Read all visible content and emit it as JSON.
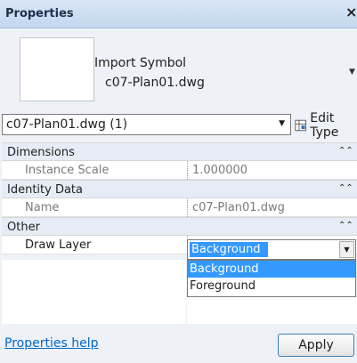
{
  "window": {
    "title": "Properties",
    "close_glyph": "×"
  },
  "type_selector": {
    "family": "Import Symbol",
    "type_name": "c07-Plan01.dwg",
    "dropdown_arrow": "▼"
  },
  "instance_filter": {
    "value": "c07-Plan01.dwg (1)",
    "arrow": "▼"
  },
  "edit_type": {
    "label": "Edit Type"
  },
  "groups": {
    "dimensions": {
      "label": "Dimensions",
      "collapse_glyph": "⌃⌃"
    },
    "identity": {
      "label": "Identity Data",
      "collapse_glyph": "⌃⌃"
    },
    "other": {
      "label": "Other",
      "collapse_glyph": "⌃⌃"
    }
  },
  "properties": {
    "instance_scale": {
      "name": "Instance Scale",
      "value": "1.000000"
    },
    "name": {
      "name": "Name",
      "value": "c07-Plan01.dwg"
    },
    "draw_layer": {
      "name": "Draw Layer",
      "value": "Background"
    }
  },
  "draw_layer_options": [
    "Background",
    "Foreground"
  ],
  "draw_layer_highlighted": "Background",
  "footer": {
    "help_link": "Properties help",
    "apply_label": "Apply"
  },
  "colors": {
    "selection": "#3399ff",
    "link": "#0066cc",
    "header_bg": "#e6ecf5"
  },
  "icons": {
    "close": "close-icon",
    "edit_type": "edit-type-icon",
    "collapse": "collapse-icon",
    "dropdown": "chevron-down-icon"
  }
}
